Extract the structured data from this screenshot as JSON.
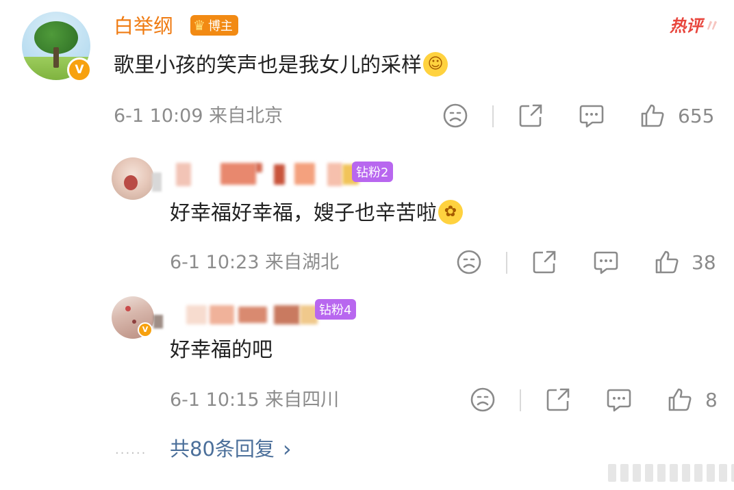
{
  "main_comment": {
    "username": "白举纲",
    "role_badge": "博主",
    "hot_label": "热评",
    "text": "歌里小孩的笑声也是我女儿的采样",
    "emoji": "sunflower-smile-emoji",
    "time": "6-1 10:09",
    "location": "来自北京",
    "likes": "655"
  },
  "replies": [
    {
      "level_badge": "钻粉2",
      "text": "好幸福好幸福，嫂子也辛苦啦",
      "emoji": "flower-laugh-emoji",
      "time": "6-1 10:23",
      "location": "来自湖北",
      "likes": "38"
    },
    {
      "level_badge": "钻粉4",
      "text": "好幸福的吧",
      "time": "6-1 10:15",
      "location": "来自四川",
      "likes": "8"
    }
  ],
  "more_replies": {
    "label": "共80条回复",
    "arrow": "›"
  },
  "icons": [
    "dislike-face-icon",
    "share-icon",
    "comment-icon",
    "like-thumb-icon",
    "crown-icon",
    "verified-v-icon"
  ],
  "colors": {
    "username": "#ef7b12",
    "badge_orange": "#f28a13",
    "badge_purple": "#b867ef",
    "link": "#4b6f9a",
    "hot": "#e8453c"
  }
}
